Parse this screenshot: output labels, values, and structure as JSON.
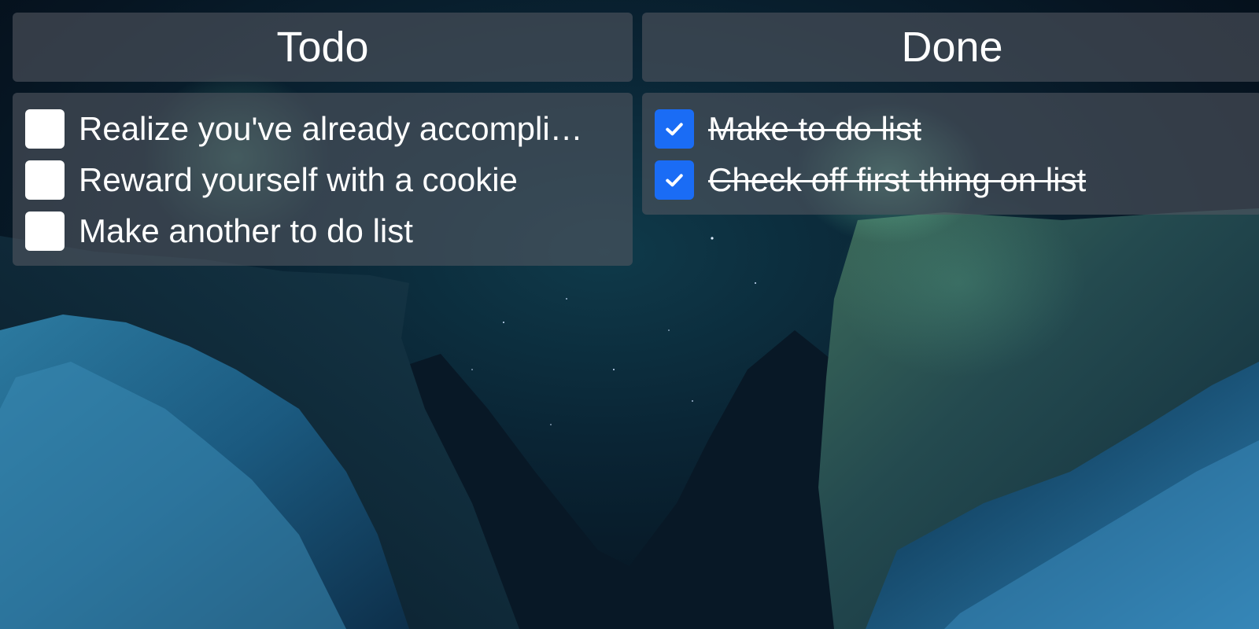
{
  "todo": {
    "title": "Todo",
    "items": [
      {
        "label": "Realize you've already accomplished two things on the list",
        "checked": false
      },
      {
        "label": "Reward yourself with a cookie",
        "checked": false
      },
      {
        "label": "Make another to do list",
        "checked": false
      }
    ]
  },
  "done": {
    "title": "Done",
    "items": [
      {
        "label": "Make to do list",
        "checked": true
      },
      {
        "label": "Check off first thing on list",
        "checked": true
      }
    ]
  },
  "colors": {
    "checkbox_checked": "#1a6cf5",
    "checkbox_unchecked": "#ffffff",
    "panel_bg": "rgba(80,86,96,0.62)",
    "text": "#ffffff"
  },
  "icons": {
    "checked": "check-icon"
  }
}
